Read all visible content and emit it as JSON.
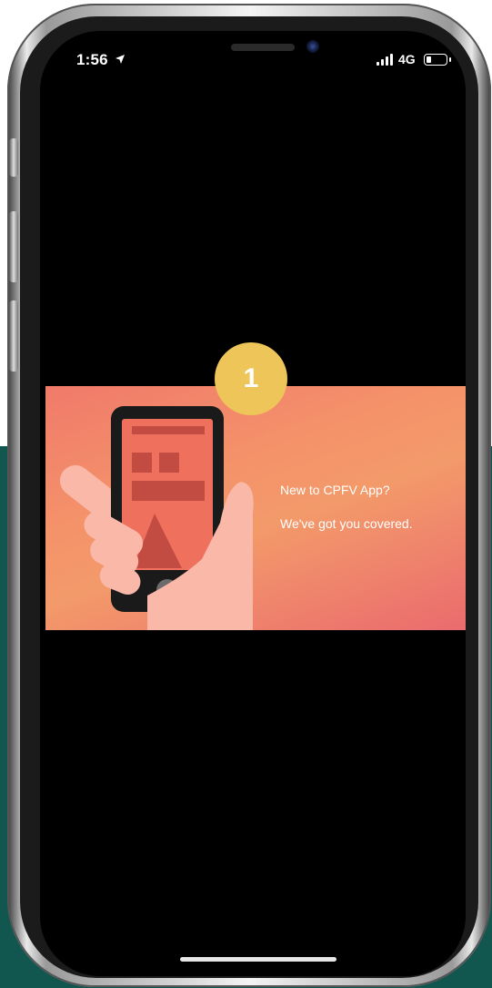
{
  "status_bar": {
    "time": "1:56",
    "location_icon": "location-arrow-icon",
    "network": "4G",
    "signal_icon": "cellular-signal-icon",
    "battery_icon": "battery-icon",
    "battery_level": 0.2
  },
  "tutorial": {
    "step_number": "1",
    "line1": "New to CPFV App?",
    "line2": "We've got you covered.",
    "illustration": "hand-holding-phone-illustration"
  },
  "colors": {
    "badge": "#eec558",
    "banner_start": "#f07a6a",
    "banner_end": "#ea6a6e",
    "background_teal": "#12574f"
  }
}
